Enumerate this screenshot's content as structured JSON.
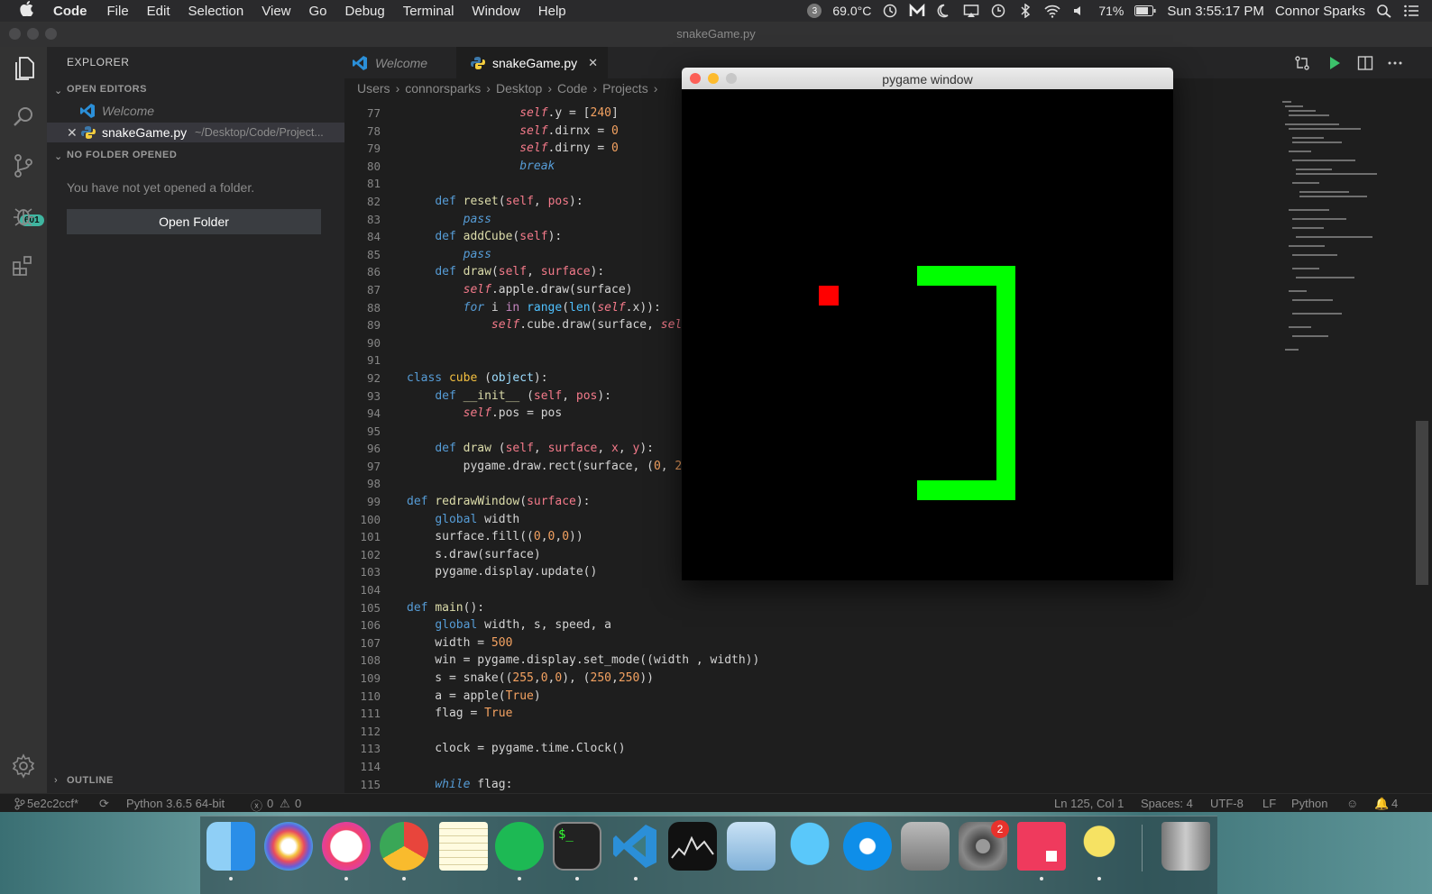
{
  "menubar": {
    "app_name": "Code",
    "menus": [
      "File",
      "Edit",
      "Selection",
      "View",
      "Go",
      "Debug",
      "Terminal",
      "Window",
      "Help"
    ],
    "badge_count": "3",
    "temperature": "69.0°C",
    "battery": "71%",
    "clock": "Sun 3:55:17 PM",
    "user": "Connor Sparks"
  },
  "window": {
    "title": "snakeGame.py"
  },
  "activity": {
    "source_control_badge": "601"
  },
  "sidebar": {
    "title": "EXPLORER",
    "open_editors_label": "OPEN EDITORS",
    "open_editors": [
      {
        "name": "Welcome",
        "path": ""
      },
      {
        "name": "snakeGame.py",
        "path": "~/Desktop/Code/Project..."
      }
    ],
    "no_folder_label": "NO FOLDER OPENED",
    "no_folder_message": "You have not yet opened a folder.",
    "open_folder_button": "Open Folder",
    "outline_label": "OUTLINE"
  },
  "tabs": [
    {
      "label": "Welcome"
    },
    {
      "label": "snakeGame.py"
    }
  ],
  "breadcrumb": [
    "Users",
    "connorsparks",
    "Desktop",
    "Code",
    "Projects"
  ],
  "editor": {
    "line_numbers": [
      "77",
      "78",
      "79",
      "80",
      "81",
      "82",
      "83",
      "84",
      "85",
      "86",
      "87",
      "88",
      "89",
      "90",
      "91",
      "92",
      "93",
      "94",
      "95",
      "96",
      "97",
      "98",
      "99",
      "100",
      "101",
      "102",
      "103",
      "104",
      "105",
      "106",
      "107",
      "108",
      "109",
      "110",
      "111",
      "112",
      "113",
      "114",
      "115"
    ]
  },
  "pygame": {
    "title": "pygame window",
    "apple_color": "#ff0000",
    "snake_color": "#00ff00",
    "background_color": "#000000"
  },
  "statusbar": {
    "branch": "5e2c2ccf*",
    "interpreter": "Python 3.6.5 64-bit",
    "errors": "0",
    "warnings": "0",
    "cursor": "Ln 125, Col 1",
    "spaces": "Spaces: 4",
    "encoding": "UTF-8",
    "eol": "LF",
    "language": "Python",
    "notifications": "4"
  },
  "dock": {
    "apps": [
      "Finder",
      "Photos",
      "iTunes",
      "Chrome",
      "Notes",
      "Spotify",
      "Terminal",
      "VS Code",
      "Stocks",
      "Mail",
      "Messages",
      "TeamViewer",
      "Disk Utility",
      "System Preferences",
      "Pygame",
      "Cyberduck",
      "Trash"
    ],
    "system_preferences_badge": "2"
  }
}
